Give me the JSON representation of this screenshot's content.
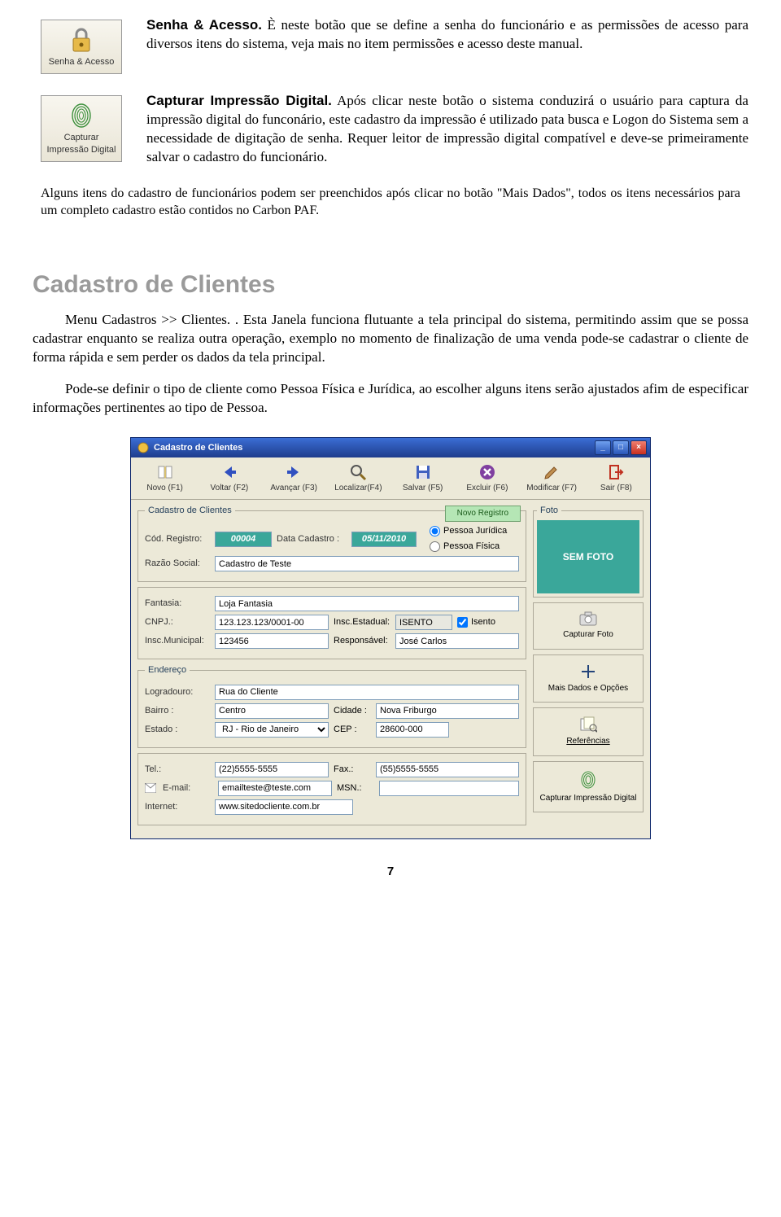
{
  "section1": {
    "btn_label": "Senha & Acesso",
    "title": "Senha & Acesso.",
    "body": " È neste botão que se define a senha do funcionário e as permissões de acesso para diversos itens do sistema, veja mais no item permissões e acesso deste manual."
  },
  "section2": {
    "btn_line1": "Capturar",
    "btn_line2": "Impressão Digital",
    "title": "Capturar Impressão Digital.",
    "body": " Após clicar neste botão o sistema conduzirá o usuário para captura da impressão digital do funconário, este cadastro da impressão é utilizado pata busca e Logon do Sistema sem a necessidade de digitação de senha. Requer leitor de impressão digital compatível e deve-se primeiramente salvar o cadastro do funcionário."
  },
  "note": "Alguns itens do cadastro de funcionários podem ser preenchidos após clicar no botão \"Mais Dados\",  todos os itens necessários para um completo cadastro estão contidos no Carbon PAF.",
  "heading": "Cadastro de Clientes",
  "p1": "Menu Cadastros >> Clientes. . Esta Janela funciona flutuante a tela principal do sistema, permitindo assim que se possa cadastrar enquanto se realiza outra operação, exemplo no momento de finalização de uma venda pode-se cadastrar o cliente de forma rápida e sem perder os dados da tela principal.",
  "p2": "Pode-se definir o tipo de cliente como Pessoa Física e Jurídica, ao escolher alguns itens serão ajustados afim de especificar informações pertinentes ao tipo de Pessoa.",
  "win": {
    "title": "Cadastro de Clientes",
    "toolbar": [
      {
        "label": "Novo (F1)"
      },
      {
        "label": "Voltar (F2)"
      },
      {
        "label": "Avançar (F3)"
      },
      {
        "label": "Localizar(F4)"
      },
      {
        "label": "Salvar (F5)"
      },
      {
        "label": "Excluir (F6)"
      },
      {
        "label": "Modificar (F7)"
      },
      {
        "label": "Sair (F8)"
      }
    ],
    "group_title": "Cadastro de Clientes",
    "status": "Novo Registro",
    "labels": {
      "cod": "Cód. Registro:",
      "data": "Data Cadastro :",
      "razao": "Razão Social:",
      "pj": "Pessoa Jurídica",
      "pf": "Pessoa Física",
      "fantasia": "Fantasia:",
      "cnpj": "CNPJ.:",
      "insc_est": "Insc.Estadual:",
      "isento": "Isento",
      "insc_mun": "Insc.Municipal:",
      "resp": "Responsável:",
      "endereco": "Endereço",
      "logradouro": "Logradouro:",
      "bairro": "Bairro :",
      "cidade": "Cidade :",
      "estado": "Estado :",
      "cep": "CEP :",
      "tel": "Tel.:",
      "fax": "Fax.:",
      "email": "E-mail:",
      "msn": "MSN.:",
      "internet": "Internet:",
      "foto": "Foto",
      "semfoto": "SEM FOTO",
      "capfoto": "Capturar Foto",
      "maisdados": "Mais Dados e Opções",
      "refs": "Referências",
      "capdig": "Capturar Impressão Digital"
    },
    "values": {
      "cod": "00004",
      "data": "05/11/2010",
      "razao": "Cadastro de Teste",
      "fantasia": "Loja Fantasia",
      "cnpj": "123.123.123/0001-00",
      "insc_est": "ISENTO",
      "insc_mun": "123456",
      "resp": "José Carlos",
      "logradouro": "Rua do Cliente",
      "bairro": "Centro",
      "cidade": "Nova Friburgo",
      "estado": "RJ - Rio de Janeiro",
      "cep": "28600-000",
      "tel": "(22)5555-5555",
      "fax": "(55)5555-5555",
      "email": "emailteste@teste.com",
      "msn": "",
      "internet": "www.sitedocliente.com.br"
    }
  },
  "page_num": "7"
}
